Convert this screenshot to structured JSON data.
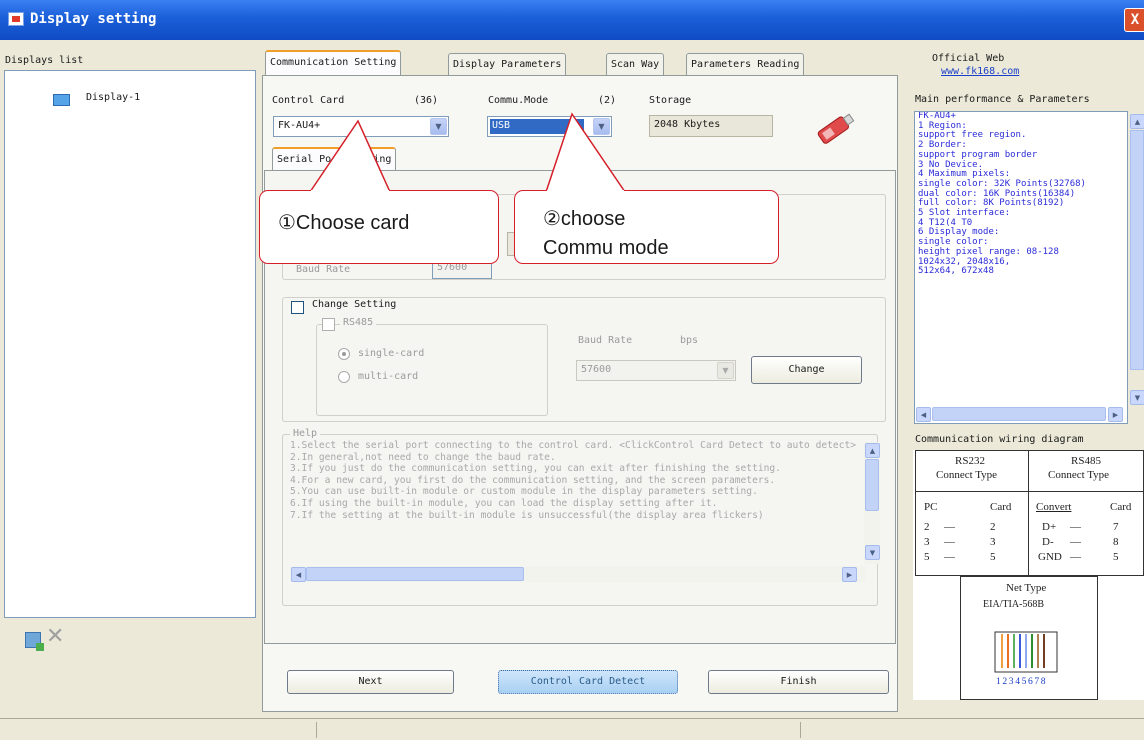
{
  "window": {
    "title": "Display setting",
    "close_label": "X"
  },
  "left_panel": {
    "list_label": "Displays list",
    "items": [
      {
        "label": "Display-1"
      }
    ]
  },
  "tabs": [
    {
      "label": "Communication Setting",
      "active": true
    },
    {
      "label": "Display Parameters",
      "active": false
    },
    {
      "label": "Scan Way",
      "active": false
    },
    {
      "label": "Parameters Reading",
      "active": false
    }
  ],
  "comm": {
    "control_card_label": "Control Card",
    "control_card_count": "(36)",
    "control_card_value": "FK-AU4+",
    "commu_mode_label": "Commu.Mode",
    "commu_mode_count": "(2)",
    "commu_mode_value": "USB",
    "storage_label": "Storage",
    "storage_value": "2048 Kbytes"
  },
  "sub_tab": {
    "label": "Serial Port Setting"
  },
  "change_setting": {
    "title": "Change Setting",
    "rs485_label": "RS485",
    "single_card": "single-card",
    "multi_card": "multi-card",
    "baud_rate_label": "Baud Rate",
    "baud_unit": "bps",
    "baud_value": "57600",
    "change_button": "Change"
  },
  "hidden_row": {
    "baud_label": "Baud Rate",
    "baud_value": "57600"
  },
  "help": {
    "title": "Help",
    "lines": [
      "1.Select the serial port connecting to the control card. <ClickControl Card Detect to auto detect>",
      "2.In general,not need to change the baud rate.",
      "3.If you just do the communication setting, you can exit after finishing the setting.",
      "4.For a new card, you first do the communication setting, and the screen parameters.",
      "5.You can use built-in module or custom module in the display parameters setting.",
      "6.If using the built-in module, you can load the display setting after it.",
      "7.If the setting at the built-in module is unsuccessful(the display area flickers)"
    ]
  },
  "buttons": {
    "next": "Next",
    "detect": "Control Card Detect",
    "finish": "Finish"
  },
  "callouts": {
    "choose_card": "①Choose card",
    "choose_commu_line1": "②choose",
    "choose_commu_line2": "Commu mode"
  },
  "right_panel": {
    "official_web_label": "Official Web",
    "official_web_url": "www.fk168.com",
    "main_perf_label": "Main performance & Parameters",
    "perf_lines": [
      "FK-AU4+",
      "1 Region:",
      "   support free region.",
      "2 Border:",
      "   support program border",
      "3 No Device.",
      "4 Maximum pixels:",
      "   single color: 32K Points(32768)",
      "   dual color: 16K Points(16384)",
      "   full color: 8K Points(8192)",
      "5 Slot interface:",
      "   4 T12(4 T0",
      "6 Display mode:",
      "   single color:",
      "   height pixel range: 08-128",
      "   1024x32, 2048x16,",
      "   512x64, 672x48"
    ],
    "wiring_label": "Communication wiring diagram",
    "wiring": {
      "rs232_title1": "RS232",
      "rs232_title2": "Connect Type",
      "rs485_title1": "RS485",
      "rs485_title2": "Connect Type",
      "pc": "PC",
      "card": "Card",
      "convert": "Convert",
      "card2": "Card",
      "rs232_rows": [
        [
          "2",
          "2"
        ],
        [
          "3",
          "3"
        ],
        [
          "5",
          "5"
        ]
      ],
      "rs485_rows": [
        [
          "D+",
          "7"
        ],
        [
          "D-",
          "8"
        ],
        [
          "GND",
          "5"
        ]
      ],
      "net_title": "Net Type",
      "net_std": "EIA/TIA-568B",
      "pins": "12345678"
    }
  },
  "colors": {
    "title_bar": "#1b5fd8",
    "callout_border": "#d5202a",
    "tab_highlight": "#f0a02a",
    "link": "#1a3fc8"
  }
}
